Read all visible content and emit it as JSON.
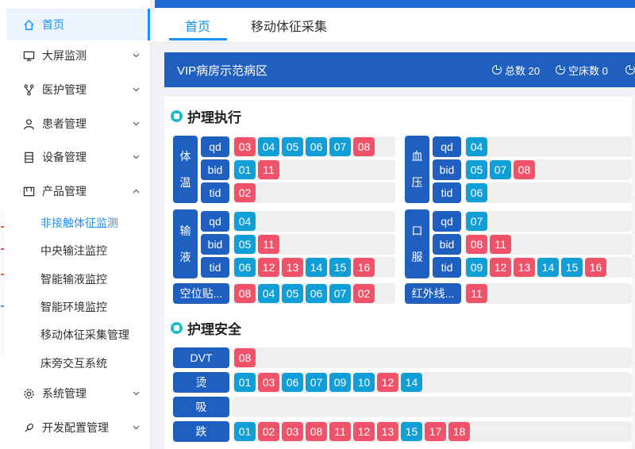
{
  "sidebar": {
    "items": [
      {
        "label": "首页",
        "icon": "home-icon"
      },
      {
        "label": "大屏监测",
        "icon": "monitor-icon"
      },
      {
        "label": "医护管理",
        "icon": "branch-icon"
      },
      {
        "label": "患者管理",
        "icon": "user-icon"
      },
      {
        "label": "设备管理",
        "icon": "device-icon"
      },
      {
        "label": "产品管理",
        "icon": "product-icon"
      },
      {
        "label": "系统管理",
        "icon": "gear-icon"
      },
      {
        "label": "开发配置管理",
        "icon": "config-icon"
      }
    ],
    "sub_items": [
      "非接触体征监测",
      "中央输注监控",
      "智能输液监控",
      "智能环境监控",
      "移动体征采集管理",
      "床旁交互系统"
    ]
  },
  "tabs": [
    "首页",
    "移动体征采集"
  ],
  "ward": {
    "title": "VIP病房示范病区",
    "total": "总数 20",
    "empty": "空床数 0"
  },
  "sections": {
    "exec": "护理执行",
    "safety": "护理安全"
  },
  "groups": {
    "temp": [
      "体",
      "温"
    ],
    "bp": [
      "血",
      "压"
    ],
    "infusion": [
      "输",
      "液"
    ],
    "oral": [
      "口",
      "服"
    ]
  },
  "freq": [
    "qd",
    "bid",
    "tid"
  ],
  "chips": {
    "temp_qd": [
      "03",
      "04",
      "05",
      "06",
      "07",
      "08"
    ],
    "temp_bid": [
      "01",
      "11"
    ],
    "temp_tid": [
      "02"
    ],
    "bp_qd": [
      "04"
    ],
    "bp_bid": [
      "05",
      "07",
      "08"
    ],
    "bp_tid": [
      "06"
    ],
    "inf_qd": [
      "04"
    ],
    "inf_bid": [
      "05",
      "11"
    ],
    "inf_tid": [
      "06",
      "12",
      "13",
      "14",
      "15",
      "16"
    ],
    "oral_qd": [
      "07"
    ],
    "oral_bid": [
      "08",
      "11"
    ],
    "oral_tid": [
      "09",
      "12",
      "13",
      "14",
      "15",
      "16"
    ],
    "empty": [
      "08",
      "04",
      "05",
      "06",
      "07",
      "02"
    ],
    "infrared": [
      "11"
    ],
    "dvt": [
      "08"
    ],
    "burn": [
      "01",
      "03",
      "06",
      "07",
      "09",
      "10",
      "12",
      "14"
    ],
    "suction": [],
    "fall": [
      "01",
      "02",
      "03",
      "08",
      "11",
      "12",
      "13",
      "15",
      "17",
      "18"
    ]
  },
  "labels": {
    "empty": "空位贴...",
    "infrared": "红外线...",
    "dvt": "DVT",
    "burn": "烫",
    "suction": "吸",
    "fall": "跌"
  },
  "colors": {
    "red": "#f05369",
    "blue": "#0f9fd6",
    "navy": "#1f5fbf",
    "accent": "#1890ff"
  }
}
